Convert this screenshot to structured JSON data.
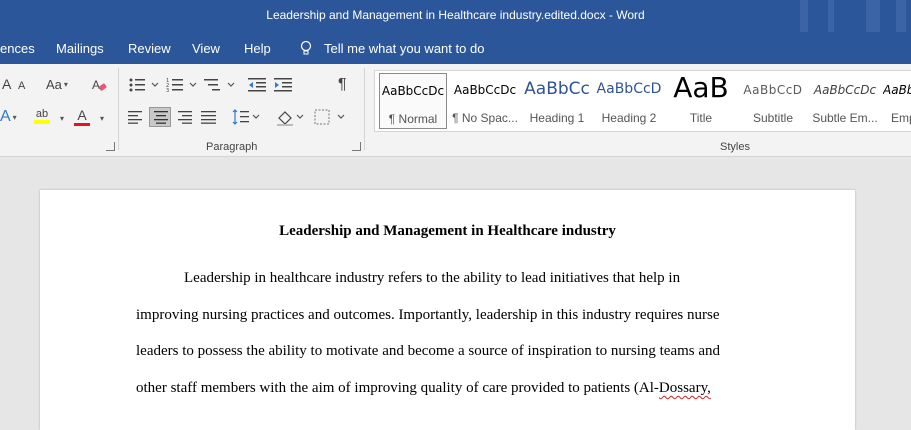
{
  "window": {
    "title": "Leadership and Management in Healthcare industry.edited.docx  -  Word"
  },
  "menu": {
    "items": [
      "ences",
      "Mailings",
      "Review",
      "View",
      "Help"
    ],
    "tell_me": "Tell me what you want to do"
  },
  "ribbon": {
    "font_group": {
      "grow_font": "A",
      "shrink_font": "A",
      "change_case": "Aa",
      "text_effects": "A",
      "highlight": "ab",
      "font_color": "A"
    },
    "paragraph": {
      "label": "Paragraph",
      "pilcrow": "¶"
    },
    "styles": {
      "label": "Styles",
      "items": [
        {
          "preview": "AaBbCcDc",
          "name": "¶ Normal"
        },
        {
          "preview": "AaBbCcDc",
          "name": "¶ No Spac..."
        },
        {
          "preview": "AaBbCc",
          "name": "Heading 1"
        },
        {
          "preview": "AaBbCcD",
          "name": "Heading 2"
        },
        {
          "preview": "AaB",
          "name": "Title"
        },
        {
          "preview": "AaBbCcD",
          "name": "Subtitle"
        },
        {
          "preview": "AaBbCcDc",
          "name": "Subtle Em..."
        },
        {
          "preview": "AaBbCcDc",
          "name": "Emp"
        }
      ]
    }
  },
  "colors": {
    "word_blue": "#2b579a",
    "highlight_yellow": "#ffff00",
    "font_color_red": "#e81123"
  },
  "document": {
    "title": "Leadership and Management in Healthcare industry",
    "lines": [
      "Leadership in healthcare industry refers to the ability to lead initiatives that help in",
      "improving nursing practices and outcomes. Importantly, leadership in this industry requires nurse",
      "leaders to possess the ability to motivate and become a source of inspiration to nursing teams and",
      "other staff members with the aim of improving quality of care provided to patients (Al-"
    ],
    "line4_end": "Dossary,"
  }
}
